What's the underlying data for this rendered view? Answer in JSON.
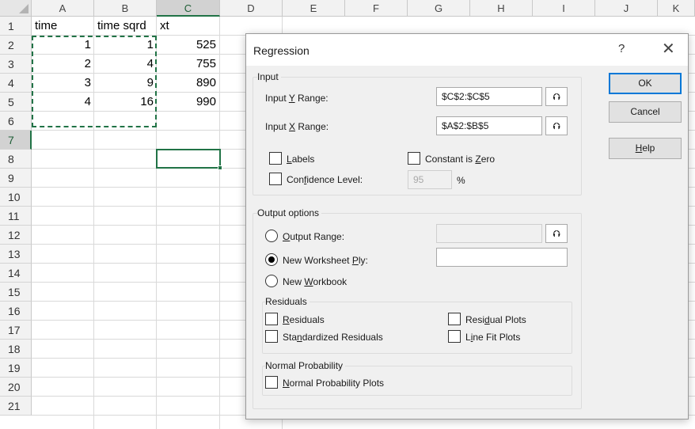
{
  "sheet": {
    "columns": [
      "A",
      "B",
      "C",
      "D",
      "E",
      "F",
      "G",
      "H",
      "I",
      "J",
      "K"
    ],
    "rows": [
      "1",
      "2",
      "3",
      "4",
      "5",
      "6",
      "7",
      "8",
      "9",
      "10",
      "11",
      "12",
      "13",
      "14",
      "15",
      "16",
      "17",
      "18",
      "19",
      "20",
      "21"
    ],
    "cells": {
      "A1": "time",
      "B1": "time sqrd",
      "C1": "xt",
      "A2": "1",
      "B2": "1",
      "C2": "525",
      "A3": "2",
      "B3": "4",
      "C3": "755",
      "A4": "3",
      "B4": "9",
      "C4": "890",
      "A5": "4",
      "B5": "16",
      "C5": "990"
    },
    "active_cell": "C7",
    "accent_color": "#217346"
  },
  "dialog": {
    "title": "Regression",
    "help_glyph": "?",
    "close_glyph": "✕",
    "input_group": {
      "label": "Input",
      "y_range_label_pre": "Input ",
      "y_range_label_u": "Y",
      "y_range_label_post": " Range:",
      "y_range_value": "$C$2:$C$5",
      "x_range_label_pre": "Input ",
      "x_range_label_u": "X",
      "x_range_label_post": " Range:",
      "x_range_value": "$A$2:$B$5",
      "labels_u": "L",
      "labels_rest": "abels",
      "constant_zero_pre": "Constant is ",
      "constant_zero_u": "Z",
      "constant_zero_post": "ero",
      "confidence_pre": "Con",
      "confidence_u": "f",
      "confidence_post": "idence Level:",
      "confidence_value": "95",
      "percent": "%"
    },
    "output_group": {
      "label": "Output options",
      "output_range_u": "O",
      "output_range_rest": "utput Range:",
      "new_worksheet_pre": "New Worksheet ",
      "new_worksheet_u": "P",
      "new_worksheet_post": "ly:",
      "new_workbook_pre": "New ",
      "new_workbook_u": "W",
      "new_workbook_post": "orkbook",
      "selected": "new_worksheet"
    },
    "residuals_group": {
      "label": "Residuals",
      "residuals_u": "R",
      "residuals_rest": "esiduals",
      "standardized_pre": "Sta",
      "standardized_u": "n",
      "standardized_post": "dardized Residuals",
      "residual_plots_pre": "Resi",
      "residual_plots_u": "d",
      "residual_plots_post": "ual Plots",
      "line_fit_pre": "L",
      "line_fit_u": "i",
      "line_fit_post": "ne Fit Plots"
    },
    "normal_group": {
      "label": "Normal Probability",
      "normal_plots_u": "N",
      "normal_plots_rest": "ormal Probability Plots"
    },
    "buttons": {
      "ok": "OK",
      "cancel": "Cancel",
      "help_u": "H",
      "help_rest": "elp"
    },
    "icons": {
      "ref_button": "collapse-range-icon",
      "ref_glyph": "⮉"
    }
  }
}
